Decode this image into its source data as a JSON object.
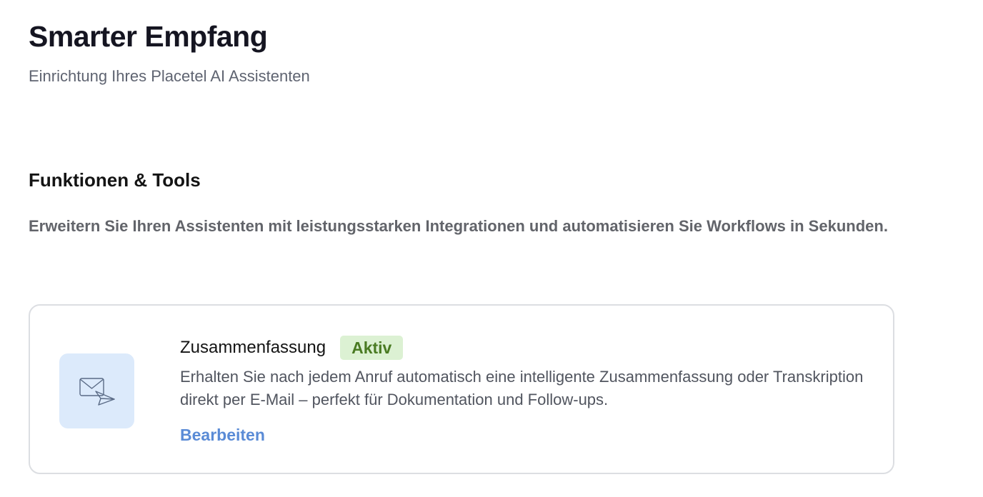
{
  "header": {
    "title": "Smarter Empfang",
    "subtitle": "Einrichtung Ihres Placetel AI Assistenten"
  },
  "section": {
    "title": "Funktionen & Tools",
    "description": "Erweitern Sie Ihren Assistenten mit leistungsstarken Integrationen und automatisieren Sie Workflows in Sekunden."
  },
  "feature": {
    "icon": "mail-send-icon",
    "name": "Zusammenfassung",
    "status": "Aktiv",
    "description": "Erhalten Sie nach jedem Anruf automatisch eine intelligente Zusammenfassung oder Transkription direkt per E-Mail – perfekt für Dokumentation und Follow-ups.",
    "edit_label": "Bearbeiten"
  },
  "colors": {
    "badge_bg": "#dcf1d3",
    "badge_text": "#4a7b23",
    "link": "#5a8bd6",
    "icon_tile": "#dceafb"
  }
}
